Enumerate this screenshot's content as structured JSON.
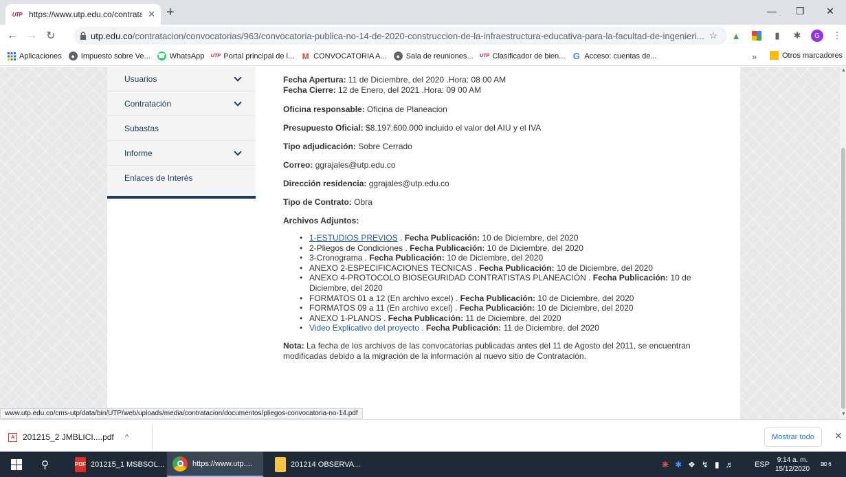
{
  "browser": {
    "tab_favicon": "UTP",
    "tab_title": "https://www.utp.edu.co/contrata",
    "tab_close": "✕",
    "new_tab": "+",
    "window": {
      "minimize": "—",
      "maximize": "❐",
      "close": "✕"
    },
    "url_host": "utp.edu.co",
    "url_path": "/contratacion/convocatorias/963/convocatoria-publica-no-14-de-2020-construccion-de-la-infraestructura-educativa-para-la-facultad-de-ingenieri...",
    "profile_initial": "G",
    "bookmarks": [
      {
        "icon": "apps-icon",
        "label": "Aplicaciones"
      },
      {
        "icon": "globe-icon",
        "label": "Impuesto sobre Ve..."
      },
      {
        "icon": "whatsapp-icon",
        "label": "WhatsApp"
      },
      {
        "icon": "utp-icon",
        "label": "Portal principal de l..."
      },
      {
        "icon": "gmail-icon",
        "label": "CONVOCATORIA A..."
      },
      {
        "icon": "globe-icon",
        "label": "Sala de reuniones..."
      },
      {
        "icon": "utp-icon",
        "label": "Clasificador de bien..."
      },
      {
        "icon": "google-icon",
        "label": "Acceso: cuentas de..."
      }
    ],
    "bookmarks_overflow": "»",
    "other_bookmarks": "Otros marcadores"
  },
  "sidebar": {
    "items": [
      {
        "label": "Usuarios",
        "has_chevron": true
      },
      {
        "label": "Contratación",
        "has_chevron": true
      },
      {
        "label": "Subastas",
        "has_chevron": false
      },
      {
        "label": "Informe",
        "has_chevron": true
      },
      {
        "label": "Enlaces de Interés",
        "has_chevron": false
      }
    ]
  },
  "details": {
    "apertura_label": "Fecha Apertura:",
    "apertura_value": " 11 de Diciembre, del 2020 .Hora: 08 00 AM",
    "cierre_label": "Fecha Cierre:",
    "cierre_value": " 12 de Enero, del 2021 .Hora: 09 00 AM",
    "oficina_label": "Oficina responsable:",
    "oficina_value": " Oficina de Planeacion",
    "presupuesto_label": "Presupuesto Oficial:",
    "presupuesto_value": " $8.197.600.000  incluido el valor del AIU y el IVA",
    "adjudicacion_label": "Tipo adjudicación:",
    "adjudicacion_value": " Sobre Cerrado",
    "correo_label": "Correo:",
    "correo_value": " ggrajales@utp.edu.co",
    "direccion_label": "Dirección residencia:",
    "direccion_value": " ggrajales@utp.edu.co",
    "contrato_label": "Tipo de Contrato:",
    "contrato_value": " Obra",
    "archivos_label": "Archivos Adjuntos:"
  },
  "files": [
    {
      "name": "1-ESTUDIOS PREVIOS",
      "style": "link-underline",
      "sep": " . ",
      "pub_label": "Fecha Publicación:",
      "pub_date": " 10 de Diciembre, del 2020"
    },
    {
      "name": "2-Pliegos de Condiciones",
      "style": "dark",
      "sep": " . ",
      "pub_label": "Fecha Publicación:",
      "pub_date": " 10 de Diciembre, del 2020"
    },
    {
      "name": "3-Cronograma",
      "style": "dark",
      "sep": " . ",
      "pub_label": "Fecha Publicación:",
      "pub_date": " 10 de Diciembre, del 2020"
    },
    {
      "name": "ANEXO 2-ESPECIFICACIONES TECNICAS",
      "style": "dark",
      "sep": " . ",
      "pub_label": "Fecha Publicación:",
      "pub_date": " 10 de Diciembre, del 2020"
    },
    {
      "name": "ANEXO 4-PROTOCOLO BIOSEGURIDAD CONTRATISTAS PLANEACIÓN",
      "style": "dark",
      "sep": " . ",
      "pub_label": "Fecha Publicación:",
      "pub_date": " 10 de Diciembre, del 2020"
    },
    {
      "name": "FORMATOS 01 a 12 (En archivo excel)",
      "style": "dark",
      "sep": " . ",
      "pub_label": "Fecha Publicación:",
      "pub_date": " 10 de Diciembre, del 2020"
    },
    {
      "name": "FORMATOS 09 a 11 (En archivo excel)",
      "style": "dark",
      "sep": " . ",
      "pub_label": "Fecha Publicación:",
      "pub_date": " 10 de Diciembre, del 2020"
    },
    {
      "name": "ANEXO 1-PLANOS",
      "style": "dark",
      "sep": " . ",
      "pub_label": "Fecha Publicación:",
      "pub_date": " 11 de Diciembre, del 2020"
    },
    {
      "name": "Video Explicativo del proyecto",
      "style": "link",
      "sep": " . ",
      "pub_label": "Fecha Publicación:",
      "pub_date": " 11 de Diciembre, del 2020"
    }
  ],
  "nota": {
    "label": "Nota:",
    "text": " La fecha de los archivos de las convocatorias publicadas antes del 11 de Agosto del 2011, se encuentran modificadas debido a la migración de la información al nuevo sitio de Contratación."
  },
  "status_url": "www.utp.edu.co/cms-utp/data/bin/UTP/web/uploads/media/contratacion/documentos/pliegos-convocatoria-no-14.pdf",
  "downloads": {
    "file": "201215_2 JMBLICI....pdf",
    "chevron": "^",
    "show_all": "Mostrar todo",
    "close": "✕"
  },
  "taskbar": {
    "items": [
      {
        "icon": "pdf-icon",
        "label": "201215_1 MSBSOL...",
        "active": false
      },
      {
        "icon": "chrome-icon",
        "label": "https://www.utp....",
        "active": true
      },
      {
        "icon": "folder-icon",
        "label": "201214 OBSERVA...",
        "active": false
      }
    ],
    "lang": "ESP",
    "time": "9:14 a. m.",
    "date": "15/12/2020",
    "notif_count": "6"
  },
  "colors": {
    "sidebar_text": "#1b3a5c",
    "link": "#2a5a9c",
    "taskbar": "#1f2a38",
    "accent_blue": "#1a73e8"
  }
}
